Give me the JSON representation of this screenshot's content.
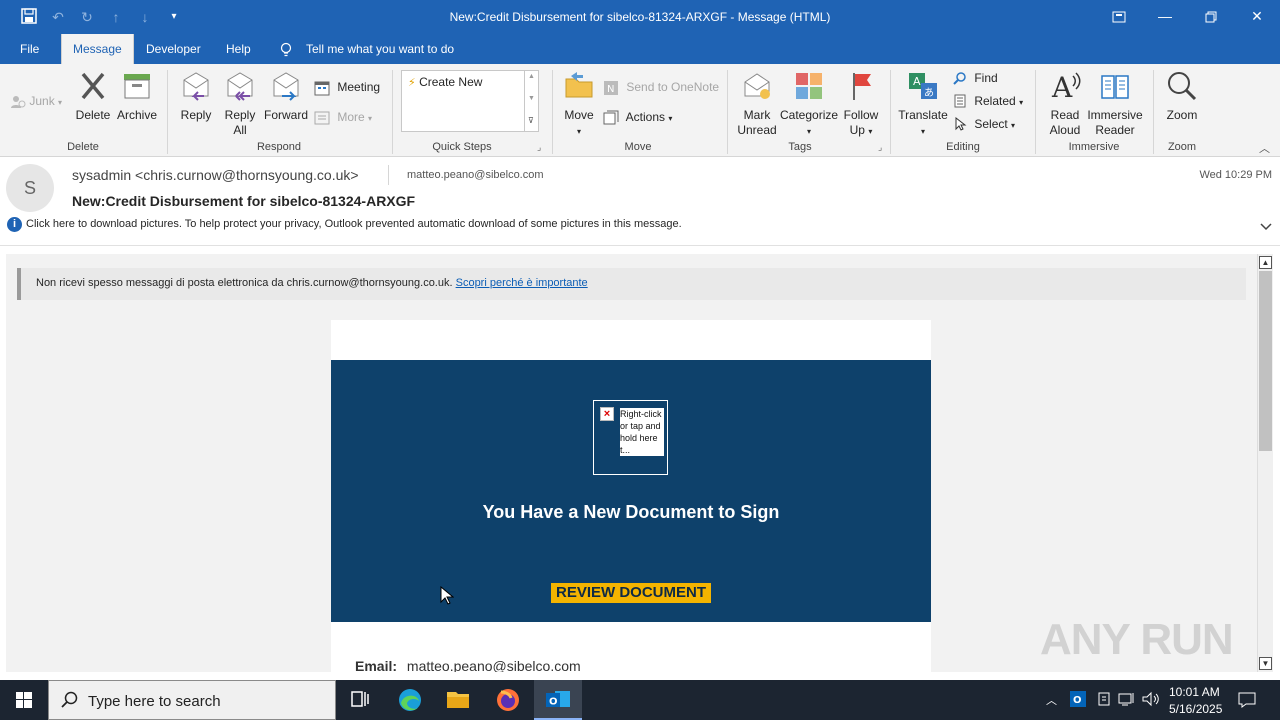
{
  "window": {
    "title": "New:Credit Disbursement for sibelco-81324-ARXGF  -  Message (HTML)"
  },
  "menu": {
    "tabs": [
      "File",
      "Message",
      "Developer",
      "Help"
    ],
    "tell_me": "Tell me what you want to do"
  },
  "ribbon": {
    "delete_group": {
      "junk": "Junk",
      "delete": "Delete",
      "archive": "Archive",
      "label": "Delete"
    },
    "respond_group": {
      "reply": "Reply",
      "reply_all_1": "Reply",
      "reply_all_2": "All",
      "forward": "Forward",
      "meeting": "Meeting",
      "more": "More",
      "label": "Respond"
    },
    "quicksteps_group": {
      "create_new": "Create New",
      "label": "Quick Steps"
    },
    "move_group": {
      "move": "Move",
      "send_onenote": "Send to OneNote",
      "actions": "Actions",
      "label": "Move"
    },
    "tags_group": {
      "mark_unread_1": "Mark",
      "mark_unread_2": "Unread",
      "categorize": "Categorize",
      "follow_up_1": "Follow",
      "follow_up_2": "Up",
      "label": "Tags"
    },
    "editing_group": {
      "translate": "Translate",
      "find": "Find",
      "related": "Related",
      "select": "Select",
      "label": "Editing"
    },
    "immersive_group": {
      "read_aloud_1": "Read",
      "read_aloud_2": "Aloud",
      "immersive_reader_1": "Immersive",
      "immersive_reader_2": "Reader",
      "label": "Immersive"
    },
    "zoom_group": {
      "zoom": "Zoom",
      "label": "Zoom"
    }
  },
  "message": {
    "avatar_letter": "S",
    "from": "sysadmin <chris.curnow@thornsyoung.co.uk>",
    "to": "matteo.peano@sibelco.com",
    "subject": "New:Credit Disbursement for sibelco-81324-ARXGF",
    "date": "Wed 10:29 PM",
    "info_bar": "Click here to download pictures. To help protect your privacy, Outlook prevented automatic download of some pictures in this message."
  },
  "body": {
    "notice_text": "Non ricevi spesso messaggi di posta elettronica da chris.curnow@thornsyoung.co.uk.",
    "notice_link": "Scopri perché è importante",
    "broken_image_alt": "Right-click or tap and hold here t...",
    "headline": "You Have a New Document to Sign",
    "review_button": "REVIEW DOCUMENT",
    "email_label": "Email:",
    "email_value": "matteo.peano@sibelco.com"
  },
  "watermark": "ANY RUN",
  "taskbar": {
    "search_placeholder": "Type here to search",
    "time": "10:01 AM",
    "date": "5/16/2025"
  },
  "colors": {
    "accent": "#1f63b4",
    "banner": "#0e416b",
    "review_button": "#f4b400",
    "taskbar": "#1c2531"
  }
}
